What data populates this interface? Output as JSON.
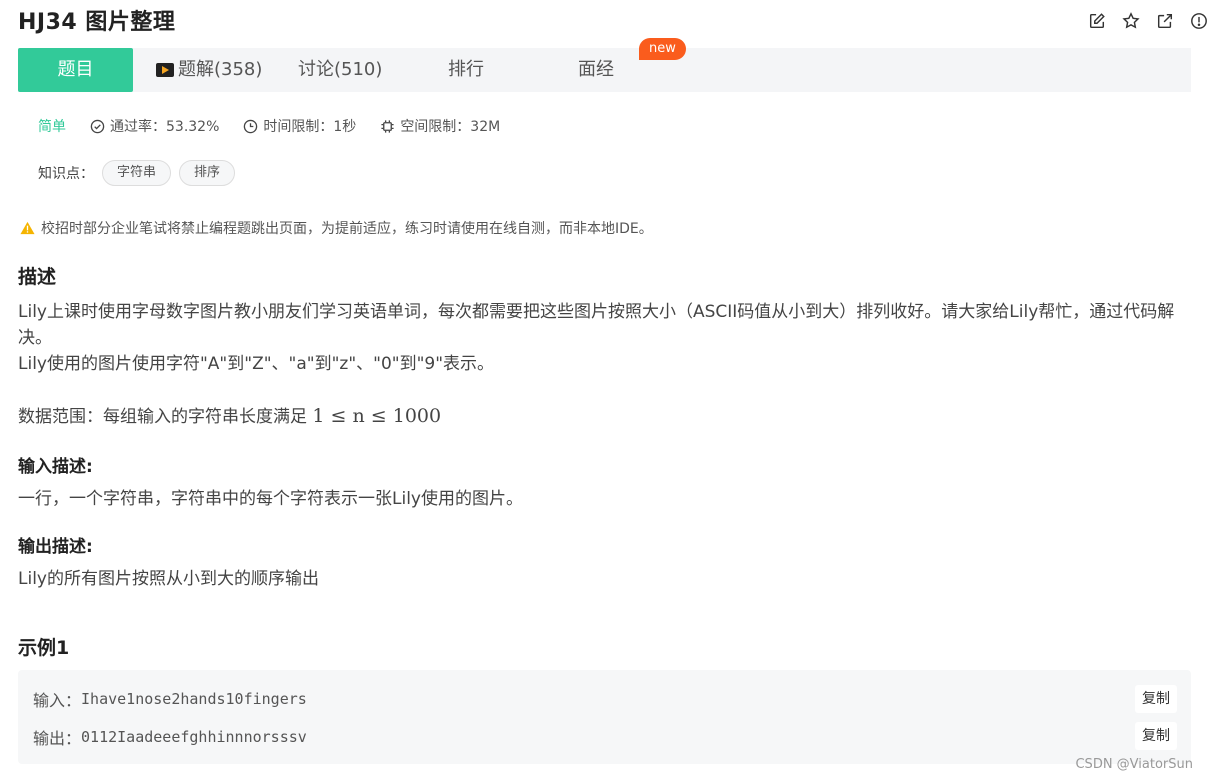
{
  "header": {
    "title": "HJ34  图片整理",
    "icons": [
      "edit-icon",
      "star-icon",
      "external-link-icon",
      "report-icon"
    ]
  },
  "tabs": {
    "problem": "题目",
    "solutions": "题解(358)",
    "discussion": "讨论(510)",
    "ranking": "排行",
    "interview": "面经",
    "new_badge": "new"
  },
  "meta": {
    "difficulty": "简单",
    "pass_rate": "通过率：53.32%",
    "time_limit": "时间限制：1秒",
    "space_limit": "空间限制：32M"
  },
  "knowledge": {
    "label": "知识点：",
    "tags": [
      "字符串",
      "排序"
    ]
  },
  "warning": "校招时部分企业笔试将禁止编程题跳出页面，为提前适应，练习时请使用在线自测，而非本地IDE。",
  "description": {
    "title": "描述",
    "line1": "Lily上课时使用字母数字图片教小朋友们学习英语单词，每次都需要把这些图片按照大小（ASCII码值从小到大）排列收好。请大家给Lily帮忙，通过代码解决。",
    "line2": "Lily使用的图片使用字符\"A\"到\"Z\"、\"a\"到\"z\"、\"0\"到\"9\"表示。",
    "range_prefix": "数据范围：每组输入的字符串长度满足 ",
    "range_math": "1 ≤ n ≤ 1000"
  },
  "input": {
    "title": "输入描述:",
    "text": "一行，一个字符串，字符串中的每个字符表示一张Lily使用的图片。"
  },
  "output": {
    "title": "输出描述:",
    "text": "Lily的所有图片按照从小到大的顺序输出"
  },
  "example": {
    "title": "示例1",
    "input_label": "输入：",
    "input_value": "Ihave1nose2hands10fingers",
    "output_label": "输出：",
    "output_value": "0112Iaadeeefghhinnnorsssv",
    "copy_label": "复制"
  },
  "watermark": "CSDN @ViatorSun",
  "colors": {
    "accent": "#32ca99",
    "badge": "#fa5c1d",
    "warning": "#f5b400"
  }
}
